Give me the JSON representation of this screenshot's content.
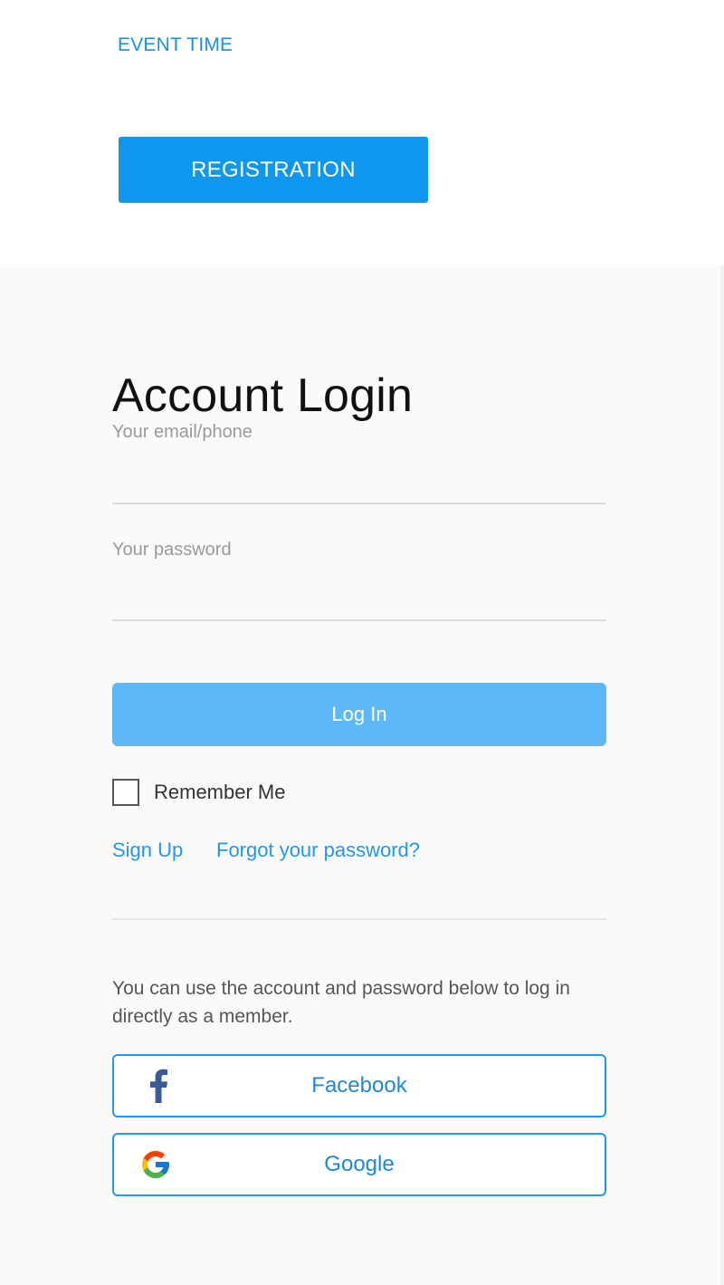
{
  "header": {
    "event_time_label": "EVENT TIME",
    "registration_label": "REGISTRATION"
  },
  "login": {
    "title": "Account Login",
    "email_label": "Your email/phone",
    "email_value": "",
    "password_label": "Your password",
    "password_value": "",
    "login_button_label": "Log In",
    "remember_me_label": "Remember Me",
    "remember_me_checked": false,
    "sign_up_link": "Sign Up",
    "forgot_password_link": "Forgot your password?",
    "info_text": "You can use the account and password below to log in directly as a member.",
    "facebook_button_label": "Facebook",
    "google_button_label": "Google"
  },
  "icons": {
    "facebook": "facebook-icon",
    "google": "google-icon"
  },
  "colors": {
    "accent": "#0f97ef",
    "link": "#2196f3",
    "login_button": "#5cb8f6",
    "facebook_blue": "#3b5998"
  }
}
